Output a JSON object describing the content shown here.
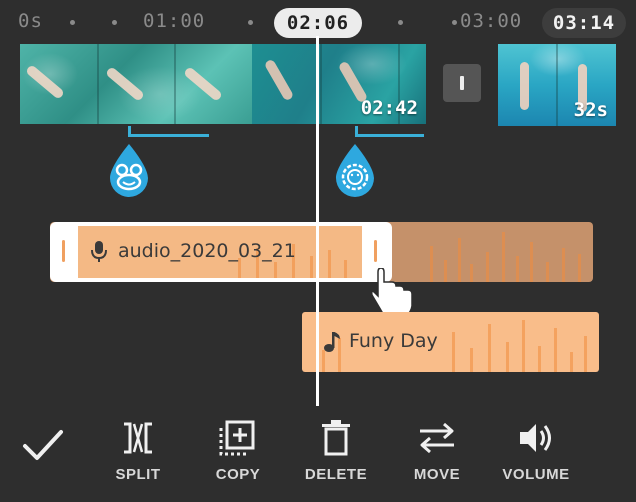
{
  "timeline": {
    "ruler_labels": [
      "0s",
      "01:00",
      "03:00"
    ],
    "playhead_time": "02:06",
    "total_duration": "03:14"
  },
  "clips": [
    {
      "id": "clip-1"
    },
    {
      "id": "clip-2",
      "duration_label": "02:42"
    },
    {
      "id": "clip-3",
      "duration_label": "32s"
    }
  ],
  "stickers": [
    {
      "icon": "frog-face-icon",
      "color": "#2ea8df"
    },
    {
      "icon": "lion-face-icon",
      "color": "#2ea8df"
    }
  ],
  "audio_tracks": [
    {
      "name": "audio_2020_03_21",
      "icon": "microphone-icon",
      "selected": true
    },
    {
      "name": "Funy Day",
      "icon": "music-note-icon",
      "selected": false
    }
  ],
  "toolbar": {
    "confirm_icon": "checkmark-icon",
    "split": "SPLIT",
    "copy": "COPY",
    "delete": "DELETE",
    "move": "MOVE",
    "volume": "VOLUME"
  },
  "colors": {
    "background": "#2e2e2e",
    "accent_blue": "#2ea8df",
    "audio_orange": "#f9bd8a"
  }
}
